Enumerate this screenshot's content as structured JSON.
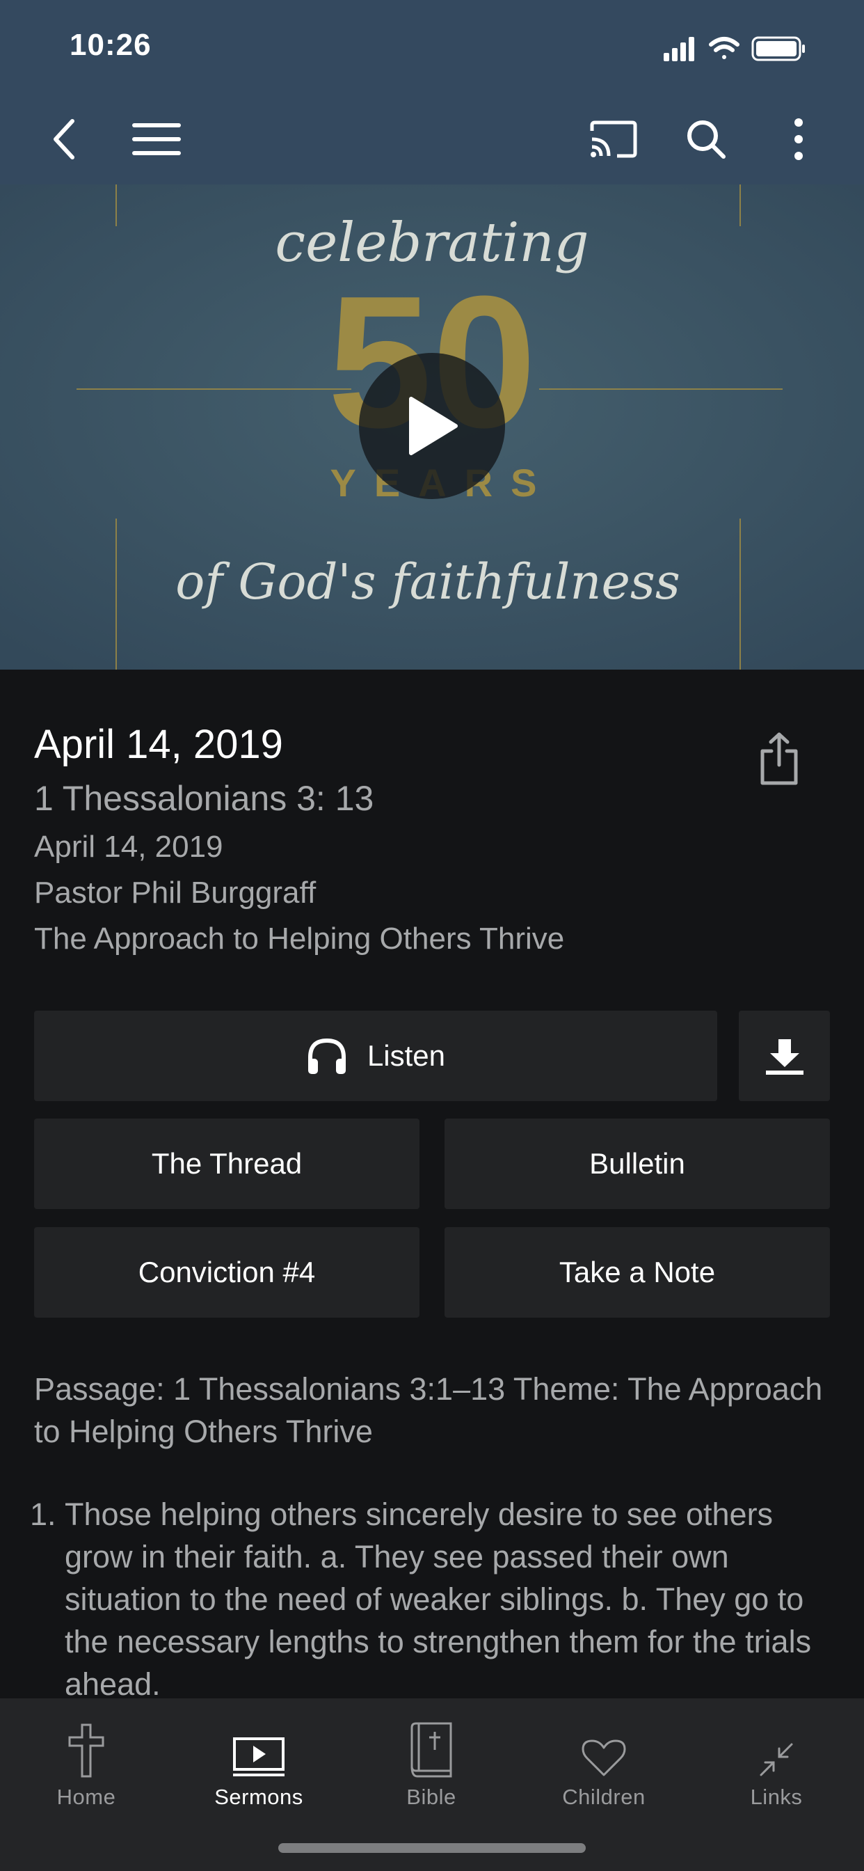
{
  "status_bar": {
    "time": "10:26"
  },
  "hero": {
    "art_text": {
      "line1": "celebrating",
      "number": "50",
      "years": "YEARS",
      "line2": "of God's faithfulness"
    }
  },
  "sermon": {
    "title": "April 14, 2019",
    "passage": "1 Thessalonians 3: 13",
    "date": "April 14, 2019",
    "speaker": "Pastor Phil Burggraff",
    "series": "The Approach to Helping Others Thrive"
  },
  "actions": {
    "listen_label": "Listen",
    "thread_label": "The Thread",
    "bulletin_label": "Bulletin",
    "conviction_label": "Conviction #4",
    "note_label": "Take a Note"
  },
  "description": {
    "intro": "Passage: 1 Thessalonians 3:1–13 Theme: The Approach to Helping Others Thrive",
    "points": [
      "Those helping others sincerely desire to see others grow in their faith. a.  They see passed their own situation to the need of weaker siblings. b.     They go to the necessary lengths to strengthen them for the trials ahead."
    ]
  },
  "tabs": [
    {
      "label": "Home",
      "icon": "cross-icon",
      "active": false
    },
    {
      "label": "Sermons",
      "icon": "video-play-icon",
      "active": true
    },
    {
      "label": "Bible",
      "icon": "bible-icon",
      "active": false
    },
    {
      "label": "Children",
      "icon": "heart-icon",
      "active": false
    },
    {
      "label": "Links",
      "icon": "arrows-in-icon",
      "active": false
    }
  ],
  "colors": {
    "header": "#34495f",
    "background": "#131416",
    "button": "#222325",
    "tabbar": "#242527",
    "gold": "#9c8a45"
  }
}
